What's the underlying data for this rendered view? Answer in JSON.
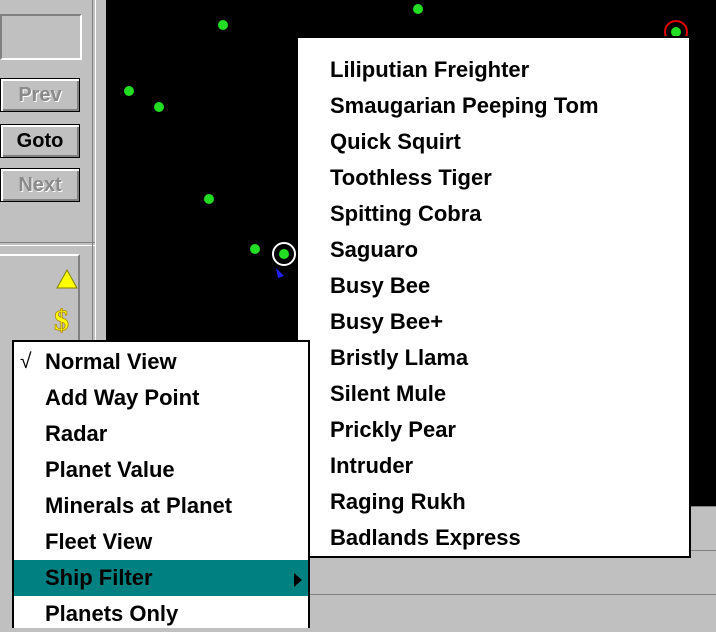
{
  "panel": {
    "prev_label": "Prev",
    "goto_label": "Goto",
    "next_label": "Next",
    "icons": [
      "triangle-up-icon",
      "dollar-sign-icon"
    ],
    "icon_color": "#ffff00"
  },
  "context_menu": {
    "items": [
      {
        "label": "Normal View",
        "checked": true
      },
      {
        "label": "Add Way Point"
      },
      {
        "label": "Radar"
      },
      {
        "label": "Planet Value"
      },
      {
        "label": "Minerals at Planet"
      },
      {
        "label": "Fleet View"
      },
      {
        "label": "Ship Filter",
        "highlighted": true,
        "has_submenu": true
      },
      {
        "label": "Planets Only"
      }
    ],
    "check_mark": "√",
    "highlight_color": "#008080"
  },
  "ship_filter_menu": {
    "items": [
      "Liliputian Freighter",
      "Smaugarian Peeping Tom",
      "Quick Squirt",
      "Toothless Tiger",
      "Spitting Cobra",
      "Saguaro",
      "Busy Bee",
      "Busy Bee+",
      "Bristly Llama",
      "Silent Mule",
      "Prickly Pear",
      "Intruder",
      "Raging Rukh",
      "Badlands Express"
    ]
  },
  "starmap": {
    "background": "#000000",
    "planet_color": "#22dd22",
    "selected_ring_color": "#dd0000"
  }
}
